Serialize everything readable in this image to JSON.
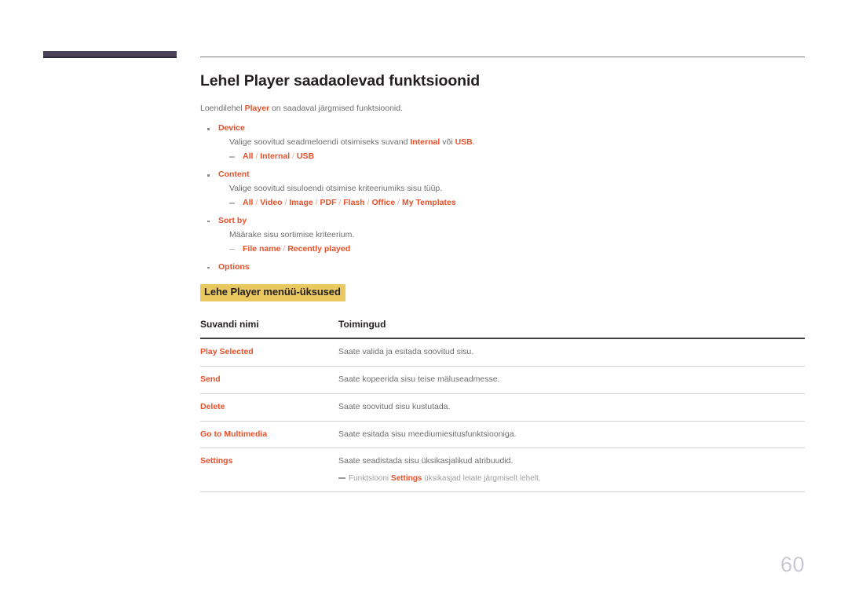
{
  "document": {
    "page_number": "60",
    "title": "Lehel Player saadaolevad funktsioonid",
    "intro": {
      "before": "Loendilehel ",
      "term": "Player",
      "after": " on saadaval järgmised funktsioonid."
    }
  },
  "bullets": [
    {
      "label": "Device",
      "description": {
        "before": "Valige soovitud seadmeloendi otsimiseks suvand ",
        "term1": "Internal",
        "middle": " või ",
        "term2": "USB",
        "after": "."
      },
      "options": [
        "All",
        "Internal",
        "USB"
      ]
    },
    {
      "label": "Content",
      "description": {
        "before": "Valige soovitud sisuloendi otsimise kriteeriumiks sisu tüüp.",
        "term1": "",
        "middle": "",
        "term2": "",
        "after": ""
      },
      "options": [
        "All",
        "Video",
        "Image",
        "PDF",
        "Flash",
        "Office",
        "My Templates"
      ]
    },
    {
      "label": "Sort by",
      "description": {
        "before": "Määrake sisu sortimise kriteerium.",
        "term1": "",
        "middle": "",
        "term2": "",
        "after": ""
      },
      "options": [
        "File name",
        "Recently played"
      ]
    },
    {
      "label": "Options",
      "description": null,
      "options": []
    }
  ],
  "section": {
    "highlighted_heading": "Lehe Player menüü-üksused"
  },
  "table": {
    "headers": [
      "Suvandi nimi",
      "Toimingud"
    ],
    "rows": [
      {
        "name": "Play Selected",
        "action": "Saate valida ja esitada soovitud sisu."
      },
      {
        "name": "Send",
        "action": "Saate kopeerida sisu teise mäluseadmesse."
      },
      {
        "name": "Delete",
        "action": "Saate soovitud sisu kustutada."
      },
      {
        "name": "Go to Multimedia",
        "action": "Saate esitada sisu meediumiesitusfunktsiooniga."
      },
      {
        "name": "Settings",
        "action": "Saate seadistada sisu üksikasjalikud atribuudid."
      }
    ],
    "note": {
      "before": "Funktsiooni ",
      "term": "Settings",
      "after": " üksikasjad leiate järgmiselt lehelt."
    }
  },
  "colors": {
    "accent_orange": "#e8502a",
    "highlight_yellow": "#e8c85f",
    "bar_purple": "#4a4058",
    "body_gray": "#6d6e70",
    "page_number_gray": "#c9c9d4"
  }
}
